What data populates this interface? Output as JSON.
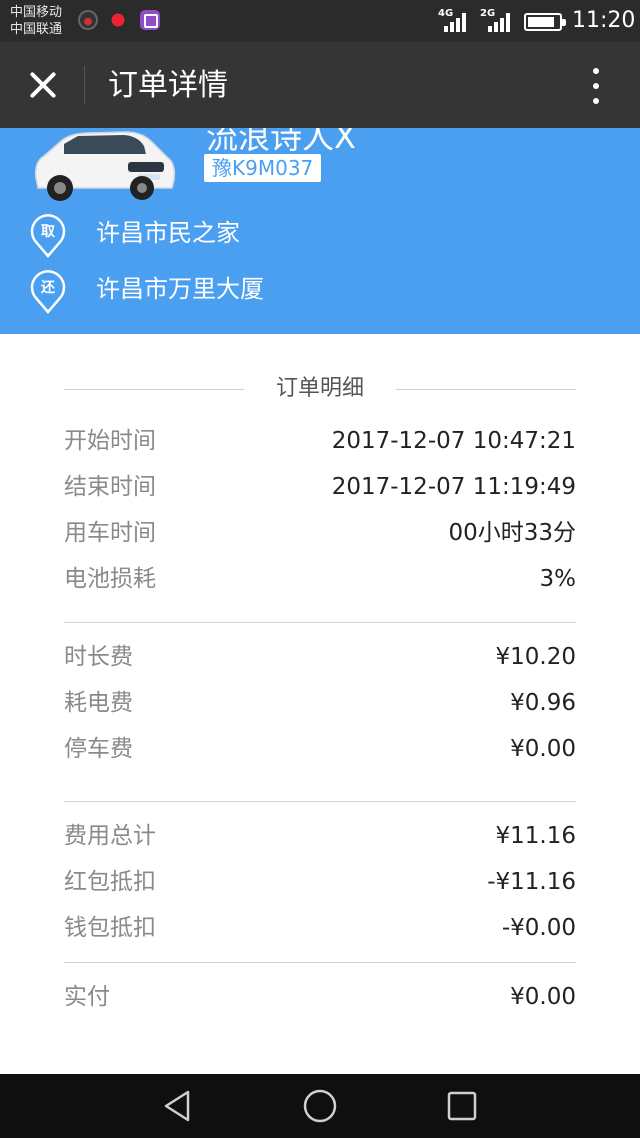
{
  "status_bar": {
    "carrier_1": "中国移动",
    "carrier_2": "中国联通",
    "net_1": "4G",
    "net_2": "2G",
    "time": "11:20"
  },
  "header": {
    "title": "订单详情",
    "close_icon": "close-icon",
    "more_icon": "more-vertical-icon"
  },
  "car": {
    "name": "流浪诗人X",
    "plate": "豫K9M037",
    "pickup_badge": "取",
    "pickup_location": "许昌市民之家",
    "return_badge": "还",
    "return_location": "许昌市万里大厦",
    "accent_color": "#4b9ff1"
  },
  "detail": {
    "section_title": "订单明细",
    "time_rows": [
      {
        "label": "开始时间",
        "value": "2017-12-07 10:47:21"
      },
      {
        "label": "结束时间",
        "value": "2017-12-07 11:19:49"
      },
      {
        "label": "用车时间",
        "value": "00小时33分"
      },
      {
        "label": "电池损耗",
        "value": "3%"
      }
    ],
    "fee_rows": [
      {
        "label": "时长费",
        "value": "¥10.20"
      },
      {
        "label": "耗电费",
        "value": "¥0.96"
      },
      {
        "label": "停车费",
        "value": "¥0.00"
      }
    ],
    "total_rows": [
      {
        "label": "费用总计",
        "value": "¥11.16"
      },
      {
        "label": "红包抵扣",
        "value": "-¥11.16"
      },
      {
        "label": "钱包抵扣",
        "value": "-¥0.00"
      }
    ],
    "paid_row": {
      "label": "实付",
      "value": "¥0.00"
    }
  },
  "nav": {
    "back_icon": "back-triangle-icon",
    "home_icon": "home-circle-icon",
    "recents_icon": "recents-square-icon"
  }
}
